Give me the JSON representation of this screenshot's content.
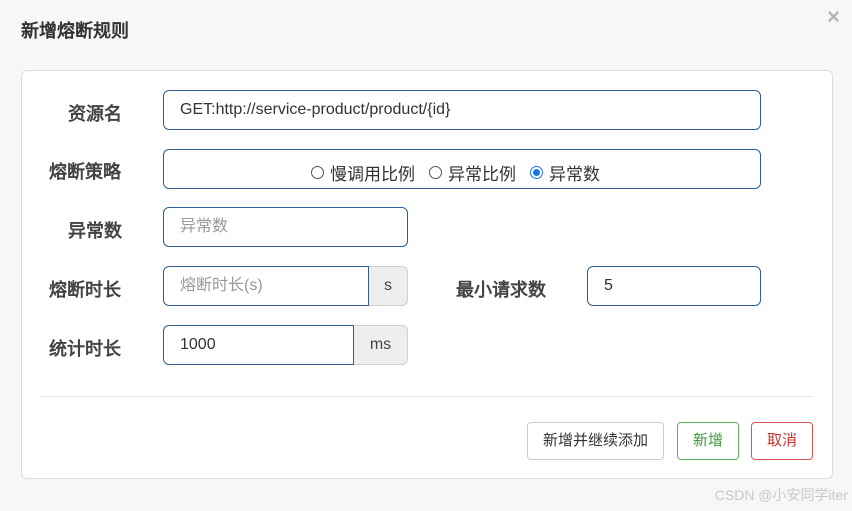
{
  "dialog": {
    "title": "新增熔断规则",
    "close_symbol": "×"
  },
  "form": {
    "resource": {
      "label": "资源名",
      "value": "GET:http://service-product/product/{id}"
    },
    "strategy": {
      "label": "熔断策略",
      "options": [
        {
          "label": "慢调用比例",
          "checked": false
        },
        {
          "label": "异常比例",
          "checked": false
        },
        {
          "label": "异常数",
          "checked": true
        }
      ]
    },
    "exception_count": {
      "label": "异常数",
      "placeholder": "异常数"
    },
    "break_duration": {
      "label": "熔断时长",
      "placeholder": "熔断时长(s)",
      "unit": "s"
    },
    "min_requests": {
      "label": "最小请求数",
      "value": "5"
    },
    "stat_duration": {
      "label": "统计时长",
      "value": "1000",
      "unit": "ms"
    }
  },
  "buttons": {
    "add_continue": "新增并继续添加",
    "add": "新增",
    "cancel": "取消"
  },
  "watermark": "CSDN @小安同学iter",
  "colors": {
    "primary_border": "#2f5d9a",
    "success": "#5cb85c",
    "danger": "#d9534f",
    "radio_checked": "#1a73e8"
  }
}
